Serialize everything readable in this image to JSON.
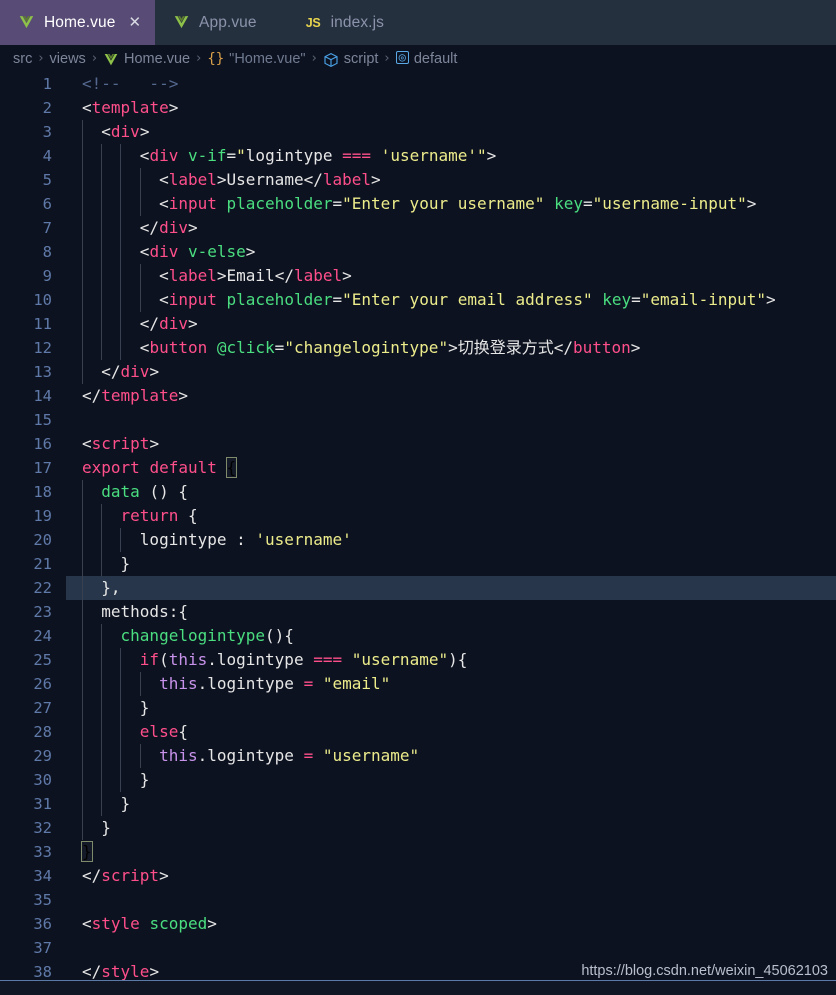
{
  "window": {
    "title": "Home.vue",
    "accent_active_tab": "#584b75",
    "editor_bg": "#0d1220",
    "tabbar_bg": "#25303f"
  },
  "tabs": [
    {
      "label": "Home.vue",
      "icon": "vue-file-icon",
      "active": true,
      "close_glyph": "✕"
    },
    {
      "label": "App.vue",
      "icon": "vue-file-icon",
      "active": false,
      "close_glyph": ""
    },
    {
      "label": "index.js",
      "icon": "js-file-icon",
      "active": false,
      "close_glyph": ""
    }
  ],
  "breadcrumb": {
    "separator": "›",
    "items": [
      {
        "label": "src",
        "icon": ""
      },
      {
        "label": "views",
        "icon": ""
      },
      {
        "label": "Home.vue",
        "icon": "vue-file-icon"
      },
      {
        "label": "\"Home.vue\"",
        "icon": "braces-icon"
      },
      {
        "label": "script",
        "icon": "cube-icon"
      },
      {
        "label": "default",
        "icon": "symbol-icon"
      }
    ]
  },
  "editor": {
    "current_line": 22,
    "first_line": 1,
    "last_line": 38,
    "line_height": 24,
    "lines": [
      {
        "n": 1,
        "indent": 0,
        "tokens": [
          {
            "t": "<!--   -->",
            "c": "t-comment"
          }
        ]
      },
      {
        "n": 2,
        "indent": 0,
        "tokens": [
          {
            "t": "<",
            "c": "t-punc"
          },
          {
            "t": "template",
            "c": "t-tag"
          },
          {
            "t": ">",
            "c": "t-punc"
          }
        ]
      },
      {
        "n": 3,
        "indent": 1,
        "tokens": [
          {
            "t": "  <",
            "c": "t-punc"
          },
          {
            "t": "div",
            "c": "t-tag"
          },
          {
            "t": ">",
            "c": "t-punc"
          }
        ]
      },
      {
        "n": 4,
        "indent": 3,
        "tokens": [
          {
            "t": "      <",
            "c": "t-punc"
          },
          {
            "t": "div",
            "c": "t-tag"
          },
          {
            "t": " ",
            "c": "t-plain"
          },
          {
            "t": "v-if",
            "c": "t-attr"
          },
          {
            "t": "=",
            "c": "t-punc"
          },
          {
            "t": "\"",
            "c": "t-str"
          },
          {
            "t": "logintype",
            "c": "t-plain"
          },
          {
            "t": " ",
            "c": "t-plain"
          },
          {
            "t": "===",
            "c": "t-op"
          },
          {
            "t": " ",
            "c": "t-plain"
          },
          {
            "t": "'username'",
            "c": "t-str"
          },
          {
            "t": "\"",
            "c": "t-str"
          },
          {
            "t": ">",
            "c": "t-punc"
          }
        ]
      },
      {
        "n": 5,
        "indent": 4,
        "tokens": [
          {
            "t": "        <",
            "c": "t-punc"
          },
          {
            "t": "label",
            "c": "t-tag"
          },
          {
            "t": ">",
            "c": "t-punc"
          },
          {
            "t": "Username",
            "c": "t-plain"
          },
          {
            "t": "</",
            "c": "t-punc"
          },
          {
            "t": "label",
            "c": "t-tag"
          },
          {
            "t": ">",
            "c": "t-punc"
          }
        ]
      },
      {
        "n": 6,
        "indent": 4,
        "tokens": [
          {
            "t": "        <",
            "c": "t-punc"
          },
          {
            "t": "input",
            "c": "t-tag"
          },
          {
            "t": " ",
            "c": "t-plain"
          },
          {
            "t": "placeholder",
            "c": "t-attr"
          },
          {
            "t": "=",
            "c": "t-punc"
          },
          {
            "t": "\"Enter your username\"",
            "c": "t-str"
          },
          {
            "t": " ",
            "c": "t-plain"
          },
          {
            "t": "key",
            "c": "t-attr"
          },
          {
            "t": "=",
            "c": "t-punc"
          },
          {
            "t": "\"username-input\"",
            "c": "t-str"
          },
          {
            "t": ">",
            "c": "t-punc"
          }
        ]
      },
      {
        "n": 7,
        "indent": 3,
        "tokens": [
          {
            "t": "      </",
            "c": "t-punc"
          },
          {
            "t": "div",
            "c": "t-tag"
          },
          {
            "t": ">",
            "c": "t-punc"
          }
        ]
      },
      {
        "n": 8,
        "indent": 3,
        "tokens": [
          {
            "t": "      <",
            "c": "t-punc"
          },
          {
            "t": "div",
            "c": "t-tag"
          },
          {
            "t": " ",
            "c": "t-plain"
          },
          {
            "t": "v-else",
            "c": "t-attr"
          },
          {
            "t": ">",
            "c": "t-punc"
          }
        ]
      },
      {
        "n": 9,
        "indent": 4,
        "tokens": [
          {
            "t": "        <",
            "c": "t-punc"
          },
          {
            "t": "label",
            "c": "t-tag"
          },
          {
            "t": ">",
            "c": "t-punc"
          },
          {
            "t": "Email",
            "c": "t-plain"
          },
          {
            "t": "</",
            "c": "t-punc"
          },
          {
            "t": "label",
            "c": "t-tag"
          },
          {
            "t": ">",
            "c": "t-punc"
          }
        ]
      },
      {
        "n": 10,
        "indent": 4,
        "tokens": [
          {
            "t": "        <",
            "c": "t-punc"
          },
          {
            "t": "input",
            "c": "t-tag"
          },
          {
            "t": " ",
            "c": "t-plain"
          },
          {
            "t": "placeholder",
            "c": "t-attr"
          },
          {
            "t": "=",
            "c": "t-punc"
          },
          {
            "t": "\"Enter your email address\"",
            "c": "t-str"
          },
          {
            "t": " ",
            "c": "t-plain"
          },
          {
            "t": "key",
            "c": "t-attr"
          },
          {
            "t": "=",
            "c": "t-punc"
          },
          {
            "t": "\"email-input\"",
            "c": "t-str"
          },
          {
            "t": ">",
            "c": "t-punc"
          }
        ]
      },
      {
        "n": 11,
        "indent": 3,
        "tokens": [
          {
            "t": "      </",
            "c": "t-punc"
          },
          {
            "t": "div",
            "c": "t-tag"
          },
          {
            "t": ">",
            "c": "t-punc"
          }
        ]
      },
      {
        "n": 12,
        "indent": 3,
        "tokens": [
          {
            "t": "      <",
            "c": "t-punc"
          },
          {
            "t": "button",
            "c": "t-tag"
          },
          {
            "t": " ",
            "c": "t-plain"
          },
          {
            "t": "@click",
            "c": "t-attr"
          },
          {
            "t": "=",
            "c": "t-punc"
          },
          {
            "t": "\"changelogintype\"",
            "c": "t-str"
          },
          {
            "t": ">",
            "c": "t-punc"
          },
          {
            "t": "切换登录方式",
            "c": "t-plain"
          },
          {
            "t": "</",
            "c": "t-punc"
          },
          {
            "t": "button",
            "c": "t-tag"
          },
          {
            "t": ">",
            "c": "t-punc"
          }
        ]
      },
      {
        "n": 13,
        "indent": 1,
        "tokens": [
          {
            "t": "  </",
            "c": "t-punc"
          },
          {
            "t": "div",
            "c": "t-tag"
          },
          {
            "t": ">",
            "c": "t-punc"
          }
        ]
      },
      {
        "n": 14,
        "indent": 0,
        "tokens": [
          {
            "t": "</",
            "c": "t-punc"
          },
          {
            "t": "template",
            "c": "t-tag"
          },
          {
            "t": ">",
            "c": "t-punc"
          }
        ]
      },
      {
        "n": 15,
        "indent": 0,
        "tokens": []
      },
      {
        "n": 16,
        "indent": 0,
        "tokens": [
          {
            "t": "<",
            "c": "t-punc"
          },
          {
            "t": "script",
            "c": "t-tag"
          },
          {
            "t": ">",
            "c": "t-punc"
          }
        ]
      },
      {
        "n": 17,
        "indent": 0,
        "tokens": [
          {
            "t": "export",
            "c": "t-kw"
          },
          {
            "t": " ",
            "c": "t-plain"
          },
          {
            "t": "default",
            "c": "t-kw"
          },
          {
            "t": " ",
            "c": "t-plain"
          },
          {
            "t": "{",
            "c": "t-match"
          }
        ]
      },
      {
        "n": 18,
        "indent": 1,
        "tokens": [
          {
            "t": "  ",
            "c": "t-plain"
          },
          {
            "t": "data",
            "c": "t-fn"
          },
          {
            "t": " ",
            "c": "t-plain"
          },
          {
            "t": "()",
            "c": "t-plain"
          },
          {
            "t": " ",
            "c": "t-plain"
          },
          {
            "t": "{",
            "c": "t-plain"
          }
        ]
      },
      {
        "n": 19,
        "indent": 2,
        "tokens": [
          {
            "t": "    ",
            "c": "t-plain"
          },
          {
            "t": "return",
            "c": "t-kw"
          },
          {
            "t": " ",
            "c": "t-plain"
          },
          {
            "t": "{",
            "c": "t-plain"
          }
        ]
      },
      {
        "n": 20,
        "indent": 3,
        "tokens": [
          {
            "t": "      ",
            "c": "t-plain"
          },
          {
            "t": "logintype",
            "c": "t-plain"
          },
          {
            "t": " : ",
            "c": "t-plain"
          },
          {
            "t": "'username'",
            "c": "t-str"
          }
        ]
      },
      {
        "n": 21,
        "indent": 2,
        "tokens": [
          {
            "t": "    }",
            "c": "t-plain"
          }
        ]
      },
      {
        "n": 22,
        "indent": 1,
        "tokens": [
          {
            "t": "  },",
            "c": "t-plain"
          }
        ]
      },
      {
        "n": 23,
        "indent": 1,
        "tokens": [
          {
            "t": "  ",
            "c": "t-plain"
          },
          {
            "t": "methods",
            "c": "t-plain"
          },
          {
            "t": ":{",
            "c": "t-plain"
          }
        ]
      },
      {
        "n": 24,
        "indent": 2,
        "tokens": [
          {
            "t": "    ",
            "c": "t-plain"
          },
          {
            "t": "changelogintype",
            "c": "t-fn"
          },
          {
            "t": "(){",
            "c": "t-plain"
          }
        ]
      },
      {
        "n": 25,
        "indent": 3,
        "tokens": [
          {
            "t": "      ",
            "c": "t-plain"
          },
          {
            "t": "if",
            "c": "t-kw"
          },
          {
            "t": "(",
            "c": "t-plain"
          },
          {
            "t": "this",
            "c": "t-this"
          },
          {
            "t": ".",
            "c": "t-plain"
          },
          {
            "t": "logintype",
            "c": "t-plain"
          },
          {
            "t": " ",
            "c": "t-plain"
          },
          {
            "t": "===",
            "c": "t-op"
          },
          {
            "t": " ",
            "c": "t-plain"
          },
          {
            "t": "\"username\"",
            "c": "t-str"
          },
          {
            "t": "){",
            "c": "t-plain"
          }
        ]
      },
      {
        "n": 26,
        "indent": 4,
        "tokens": [
          {
            "t": "        ",
            "c": "t-plain"
          },
          {
            "t": "this",
            "c": "t-this"
          },
          {
            "t": ".",
            "c": "t-plain"
          },
          {
            "t": "logintype",
            "c": "t-plain"
          },
          {
            "t": " ",
            "c": "t-plain"
          },
          {
            "t": "=",
            "c": "t-op"
          },
          {
            "t": " ",
            "c": "t-plain"
          },
          {
            "t": "\"email\"",
            "c": "t-str"
          }
        ]
      },
      {
        "n": 27,
        "indent": 3,
        "tokens": [
          {
            "t": "      }",
            "c": "t-plain"
          }
        ]
      },
      {
        "n": 28,
        "indent": 3,
        "tokens": [
          {
            "t": "      ",
            "c": "t-plain"
          },
          {
            "t": "else",
            "c": "t-kw"
          },
          {
            "t": "{",
            "c": "t-plain"
          }
        ]
      },
      {
        "n": 29,
        "indent": 4,
        "tokens": [
          {
            "t": "        ",
            "c": "t-plain"
          },
          {
            "t": "this",
            "c": "t-this"
          },
          {
            "t": ".",
            "c": "t-plain"
          },
          {
            "t": "logintype",
            "c": "t-plain"
          },
          {
            "t": " ",
            "c": "t-plain"
          },
          {
            "t": "=",
            "c": "t-op"
          },
          {
            "t": " ",
            "c": "t-plain"
          },
          {
            "t": "\"username\"",
            "c": "t-str"
          }
        ]
      },
      {
        "n": 30,
        "indent": 3,
        "tokens": [
          {
            "t": "      }",
            "c": "t-plain"
          }
        ]
      },
      {
        "n": 31,
        "indent": 2,
        "tokens": [
          {
            "t": "    }",
            "c": "t-plain"
          }
        ]
      },
      {
        "n": 32,
        "indent": 1,
        "tokens": [
          {
            "t": "  }",
            "c": "t-plain"
          }
        ]
      },
      {
        "n": 33,
        "indent": 0,
        "tokens": [
          {
            "t": "}",
            "c": "t-match"
          }
        ]
      },
      {
        "n": 34,
        "indent": 0,
        "tokens": [
          {
            "t": "</",
            "c": "t-punc"
          },
          {
            "t": "script",
            "c": "t-tag"
          },
          {
            "t": ">",
            "c": "t-punc"
          }
        ]
      },
      {
        "n": 35,
        "indent": 0,
        "tokens": []
      },
      {
        "n": 36,
        "indent": 0,
        "tokens": [
          {
            "t": "<",
            "c": "t-punc"
          },
          {
            "t": "style",
            "c": "t-tag"
          },
          {
            "t": " ",
            "c": "t-plain"
          },
          {
            "t": "scoped",
            "c": "t-attr"
          },
          {
            "t": ">",
            "c": "t-punc"
          }
        ]
      },
      {
        "n": 37,
        "indent": 0,
        "tokens": []
      },
      {
        "n": 38,
        "indent": 0,
        "tokens": [
          {
            "t": "</",
            "c": "t-punc"
          },
          {
            "t": "style",
            "c": "t-tag"
          },
          {
            "t": ">",
            "c": "t-punc"
          }
        ]
      }
    ]
  },
  "watermark": {
    "text": "https://blog.csdn.net/weixin_45062103"
  }
}
